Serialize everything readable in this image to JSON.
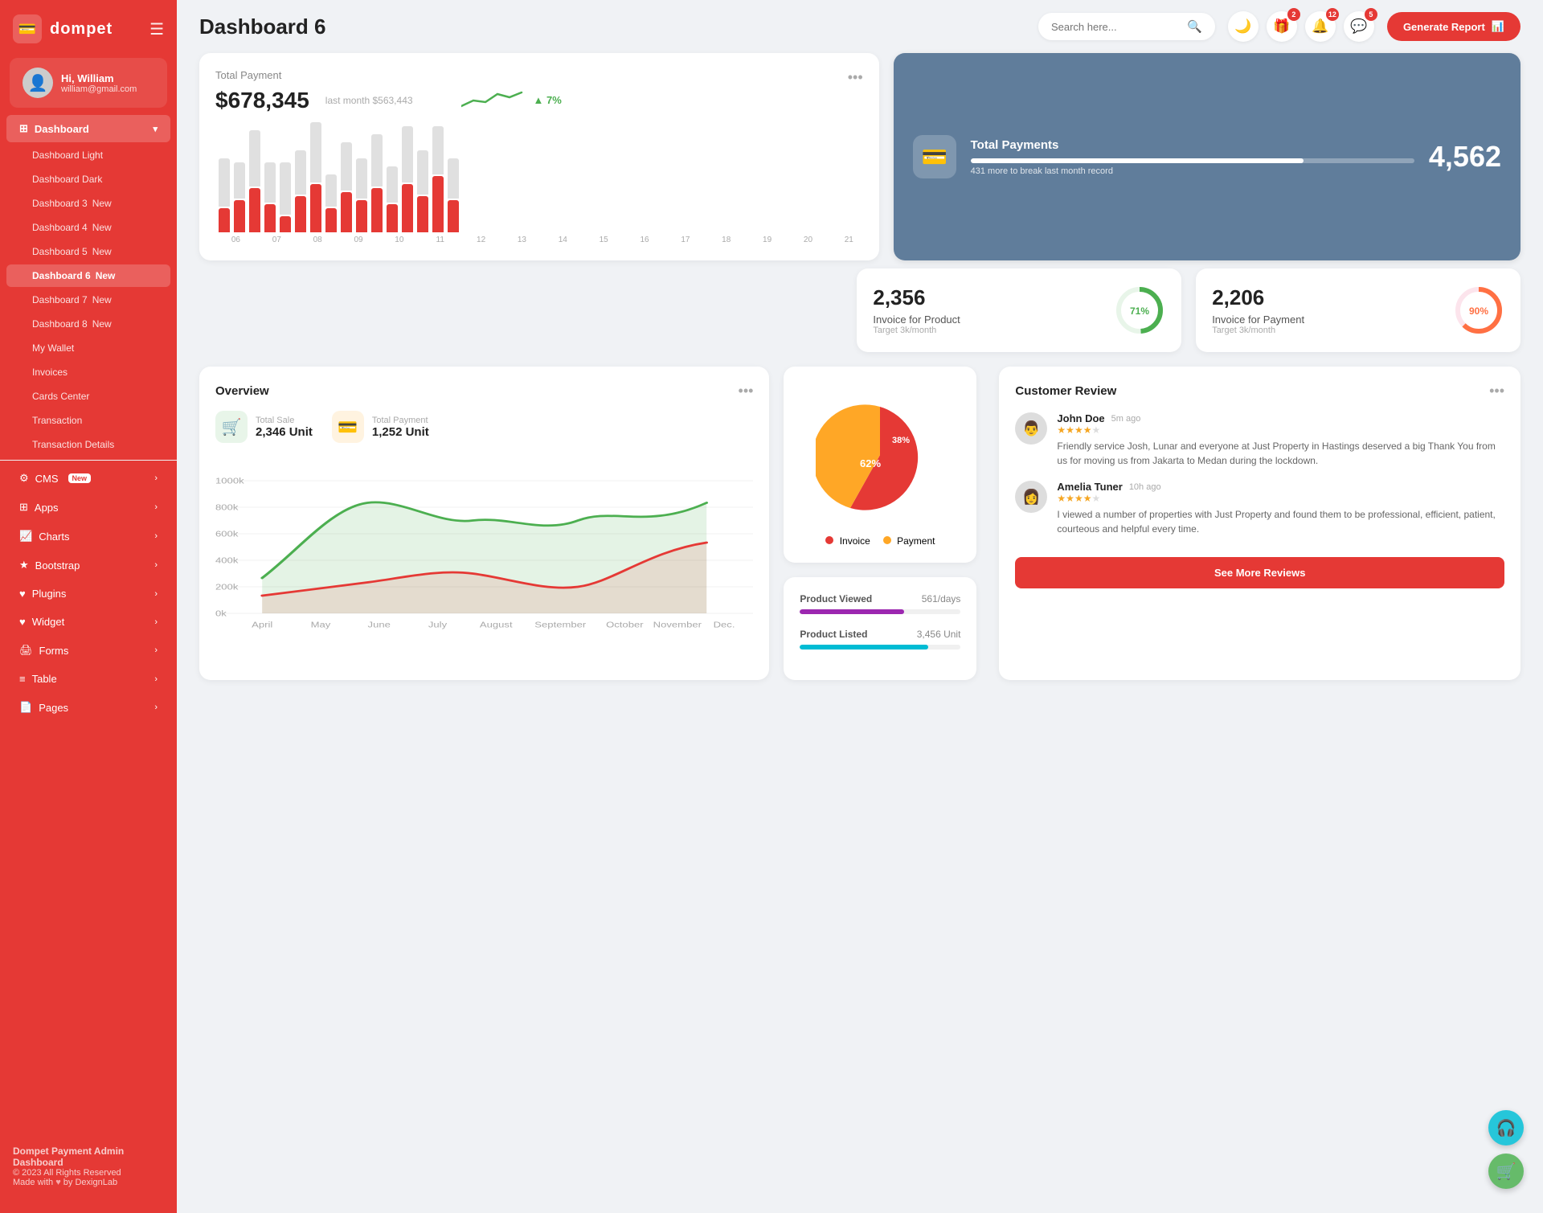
{
  "app": {
    "name": "dompet",
    "logo_icon": "💳"
  },
  "user": {
    "greeting": "Hi, William",
    "email": "william@gmail.com",
    "avatar": "👤"
  },
  "header": {
    "title": "Dashboard 6",
    "search_placeholder": "Search here...",
    "generate_report_label": "Generate Report"
  },
  "header_icons": {
    "dark_mode_badge": "",
    "gift_badge": "2",
    "bell_badge": "12",
    "message_badge": "5"
  },
  "sidebar": {
    "dashboard_label": "Dashboard",
    "items": [
      {
        "label": "Dashboard Light",
        "id": "dashboard-light"
      },
      {
        "label": "Dashboard Dark",
        "id": "dashboard-dark"
      },
      {
        "label": "Dashboard 3",
        "id": "dashboard-3",
        "badge": "New"
      },
      {
        "label": "Dashboard 4",
        "id": "dashboard-4",
        "badge": "New"
      },
      {
        "label": "Dashboard 5",
        "id": "dashboard-5",
        "badge": "New"
      },
      {
        "label": "Dashboard 6",
        "id": "dashboard-6",
        "badge": "New",
        "active": true
      },
      {
        "label": "Dashboard 7",
        "id": "dashboard-7",
        "badge": "New"
      },
      {
        "label": "Dashboard 8",
        "id": "dashboard-8",
        "badge": "New"
      },
      {
        "label": "My Wallet",
        "id": "my-wallet"
      },
      {
        "label": "Invoices",
        "id": "invoices"
      },
      {
        "label": "Cards Center",
        "id": "cards-center"
      },
      {
        "label": "Transaction",
        "id": "transaction"
      },
      {
        "label": "Transaction Details",
        "id": "transaction-details"
      }
    ],
    "nav": [
      {
        "label": "CMS",
        "id": "cms",
        "badge": "New",
        "has_arrow": true
      },
      {
        "label": "Apps",
        "id": "apps",
        "has_arrow": true
      },
      {
        "label": "Charts",
        "id": "charts",
        "has_arrow": true
      },
      {
        "label": "Bootstrap",
        "id": "bootstrap",
        "has_arrow": true
      },
      {
        "label": "Plugins",
        "id": "plugins",
        "has_arrow": true
      },
      {
        "label": "Widget",
        "id": "widget",
        "has_arrow": true
      },
      {
        "label": "Forms",
        "id": "forms",
        "has_arrow": true
      },
      {
        "label": "Table",
        "id": "table",
        "has_arrow": true
      },
      {
        "label": "Pages",
        "id": "pages",
        "has_arrow": true
      }
    ],
    "footer": {
      "brand": "Dompet Payment Admin Dashboard",
      "copyright": "© 2023 All Rights Reserved",
      "made_with": "Made with",
      "by": "by DexignLab"
    }
  },
  "total_payment": {
    "label": "Total Payment",
    "value": "$678,345",
    "last_month_label": "last month $563,443",
    "trend": "7%",
    "trend_direction": "up",
    "bars": [
      {
        "gray": 60,
        "red": 30
      },
      {
        "gray": 45,
        "red": 40
      },
      {
        "gray": 70,
        "red": 55
      },
      {
        "gray": 50,
        "red": 35
      },
      {
        "gray": 65,
        "red": 20
      },
      {
        "gray": 55,
        "red": 45
      },
      {
        "gray": 75,
        "red": 60
      },
      {
        "gray": 40,
        "red": 30
      },
      {
        "gray": 60,
        "red": 50
      },
      {
        "gray": 50,
        "red": 40
      },
      {
        "gray": 65,
        "red": 55
      },
      {
        "gray": 45,
        "red": 35
      },
      {
        "gray": 70,
        "red": 60
      },
      {
        "gray": 55,
        "red": 45
      },
      {
        "gray": 60,
        "red": 70
      },
      {
        "gray": 50,
        "red": 40
      }
    ],
    "chart_labels": [
      "06",
      "07",
      "08",
      "09",
      "10",
      "11",
      "12",
      "13",
      "14",
      "15",
      "16",
      "17",
      "18",
      "19",
      "20",
      "21"
    ]
  },
  "total_payments_blue": {
    "title": "Total Payments",
    "sub": "431 more to break last month record",
    "value": "4,562",
    "progress": 75
  },
  "invoice_product": {
    "value": "2,356",
    "label": "Invoice for Product",
    "target": "Target 3k/month",
    "percent": 71,
    "color": "#4caf50"
  },
  "invoice_payment": {
    "value": "2,206",
    "label": "Invoice for Payment",
    "target": "Target 3k/month",
    "percent": 90,
    "color": "#ff7043"
  },
  "overview": {
    "title": "Overview",
    "total_sale_label": "Total Sale",
    "total_sale_value": "2,346 Unit",
    "total_payment_label": "Total Payment",
    "total_payment_value": "1,252 Unit",
    "y_labels": [
      "1000k",
      "800k",
      "600k",
      "400k",
      "200k",
      "0k"
    ],
    "x_labels": [
      "April",
      "May",
      "June",
      "July",
      "August",
      "September",
      "October",
      "November",
      "Dec."
    ]
  },
  "pie_chart": {
    "invoice_percent": "62%",
    "payment_percent": "38%",
    "invoice_color": "#e53935",
    "payment_color": "#ffa726",
    "invoice_label": "Invoice",
    "payment_label": "Payment"
  },
  "product_stats": [
    {
      "label": "Product Viewed",
      "value": "561/days",
      "color": "#9c27b0",
      "percent": 65
    },
    {
      "label": "Product Listed",
      "value": "3,456 Unit",
      "color": "#00bcd4",
      "percent": 80
    }
  ],
  "customer_review": {
    "title": "Customer Review",
    "reviews": [
      {
        "name": "John Doe",
        "time": "5m ago",
        "stars": 4,
        "text": "Friendly service Josh, Lunar and everyone at Just Property in Hastings deserved a big Thank You from us for moving us from Jakarta to Medan during the lockdown.",
        "avatar": "👨"
      },
      {
        "name": "Amelia Tuner",
        "time": "10h ago",
        "stars": 4,
        "text": "I viewed a number of properties with Just Property and found them to be professional, efficient, patient, courteous and helpful every time.",
        "avatar": "👩"
      }
    ],
    "see_more_label": "See More Reviews"
  },
  "fab": {
    "support_icon": "🎧",
    "cart_icon": "🛒"
  }
}
